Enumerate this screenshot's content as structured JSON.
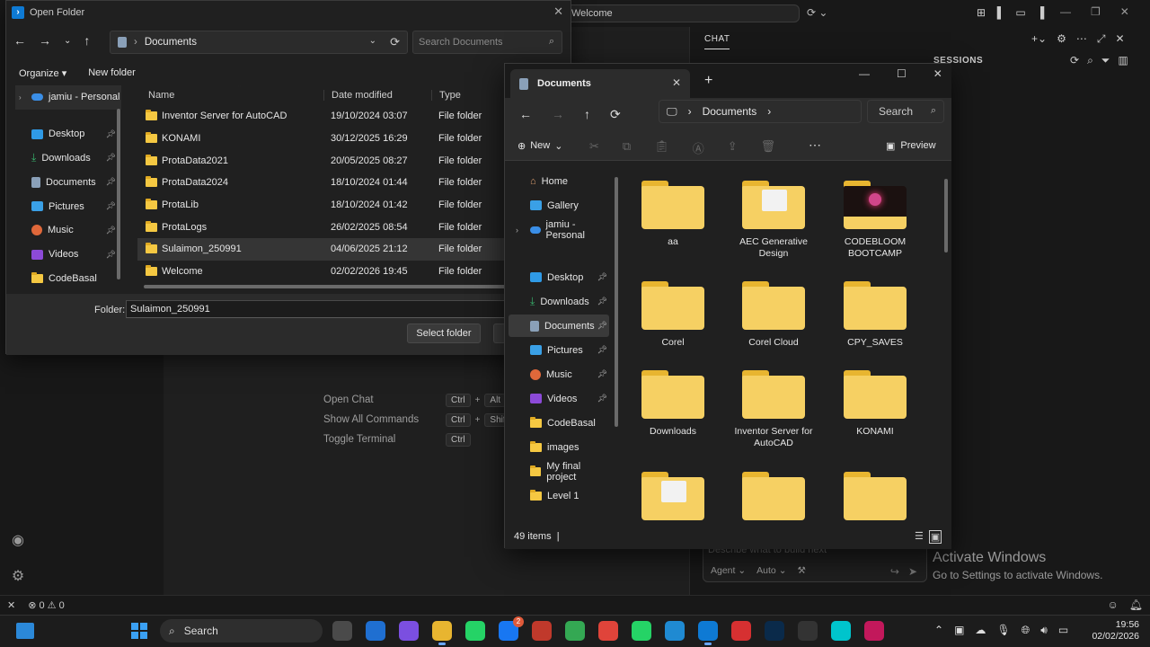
{
  "vscode": {
    "command_center": "Welcome",
    "chat_tab": "CHAT",
    "sessions_label": "SESSIONS",
    "hints": [
      {
        "label": "Open Chat",
        "keys": [
          "Ctrl",
          "Alt"
        ]
      },
      {
        "label": "Show All Commands",
        "keys": [
          "Ctrl",
          "Shift"
        ]
      },
      {
        "label": "Toggle Terminal",
        "keys": [
          "Ctrl"
        ]
      }
    ],
    "chat_placeholder": "Describe what to build next",
    "chat_mode": "Agent",
    "chat_model": "Auto",
    "status_errors": "0",
    "status_warnings": "0",
    "activate_title": "Activate Windows",
    "activate_sub": "Go to Settings to activate Windows."
  },
  "open_folder": {
    "title": "Open Folder",
    "address": "Documents",
    "search_placeholder": "Search Documents",
    "organize": "Organize",
    "new_folder": "New folder",
    "tree": [
      {
        "label": "jamiu - Personal",
        "icon": "cloud",
        "pinned": false
      },
      {
        "label": "Desktop",
        "icon": "desktop",
        "pinned": true
      },
      {
        "label": "Downloads",
        "icon": "download",
        "pinned": true
      },
      {
        "label": "Documents",
        "icon": "document",
        "pinned": true
      },
      {
        "label": "Pictures",
        "icon": "pictures",
        "pinned": true
      },
      {
        "label": "Music",
        "icon": "music",
        "pinned": true
      },
      {
        "label": "Videos",
        "icon": "videos",
        "pinned": true
      },
      {
        "label": "CodeBasal",
        "icon": "folder",
        "pinned": false
      }
    ],
    "columns": {
      "name": "Name",
      "date": "Date modified",
      "type": "Type"
    },
    "rows": [
      {
        "name": "Inventor Server for AutoCAD",
        "date": "19/10/2024 03:07",
        "type": "File folder"
      },
      {
        "name": "KONAMI",
        "date": "30/12/2025 16:29",
        "type": "File folder"
      },
      {
        "name": "ProtaData2021",
        "date": "20/05/2025 08:27",
        "type": "File folder"
      },
      {
        "name": "ProtaData2024",
        "date": "18/10/2024 01:44",
        "type": "File folder"
      },
      {
        "name": "ProtaLib",
        "date": "18/10/2024 01:42",
        "type": "File folder"
      },
      {
        "name": "ProtaLogs",
        "date": "26/02/2025 08:54",
        "type": "File folder"
      },
      {
        "name": "Sulaimon_250991",
        "date": "04/06/2025 21:12",
        "type": "File folder"
      },
      {
        "name": "Welcome",
        "date": "02/02/2026 19:45",
        "type": "File folder"
      }
    ],
    "selected_row": "Sulaimon_250991",
    "folder_label": "Folder:",
    "folder_value": "Sulaimon_250991",
    "select_button": "Select folder"
  },
  "explorer": {
    "tab_title": "Documents",
    "address": "Documents",
    "search": "Search",
    "new_label": "New",
    "preview_label": "Preview",
    "nav": [
      {
        "label": "Home",
        "icon": "home"
      },
      {
        "label": "Gallery",
        "icon": "gallery"
      },
      {
        "label": "jamiu - Personal",
        "icon": "cloud"
      },
      {
        "label": "Desktop",
        "icon": "desktop",
        "pinned": true
      },
      {
        "label": "Downloads",
        "icon": "download",
        "pinned": true
      },
      {
        "label": "Documents",
        "icon": "document",
        "pinned": true
      },
      {
        "label": "Pictures",
        "icon": "pictures",
        "pinned": true
      },
      {
        "label": "Music",
        "icon": "music",
        "pinned": true
      },
      {
        "label": "Videos",
        "icon": "videos",
        "pinned": true
      },
      {
        "label": "CodeBasal",
        "icon": "folder"
      },
      {
        "label": "images",
        "icon": "folder"
      },
      {
        "label": "My final project",
        "icon": "folder"
      },
      {
        "label": "Level 1",
        "icon": "folder"
      }
    ],
    "tiles": [
      {
        "name": "aa",
        "style": "plain"
      },
      {
        "name": "AEC Generative Design",
        "style": "paper"
      },
      {
        "name": "CODEBLOOM BOOTCAMP",
        "style": "dark"
      },
      {
        "name": "Corel",
        "style": "plain"
      },
      {
        "name": "Corel Cloud",
        "style": "plain"
      },
      {
        "name": "CPY_SAVES",
        "style": "plain"
      },
      {
        "name": "Downloads",
        "style": "plain"
      },
      {
        "name": "Inventor Server for AutoCAD",
        "style": "plain"
      },
      {
        "name": "KONAMI",
        "style": "plain"
      },
      {
        "name": "",
        "style": "paper"
      },
      {
        "name": "",
        "style": "plain"
      },
      {
        "name": "",
        "style": "plain"
      }
    ],
    "item_count": "49 items"
  },
  "taskbar": {
    "search": "Search",
    "time": "19:56",
    "date": "02/02/2026",
    "notification_count": "2",
    "apps": [
      {
        "name": "task-view",
        "color": "#4a4a4a"
      },
      {
        "name": "defender",
        "color": "#1f6fd1"
      },
      {
        "name": "copilot",
        "color": "#7b4fe0"
      },
      {
        "name": "file-explorer",
        "color": "#e8b530",
        "active": true
      },
      {
        "name": "whatsapp",
        "color": "#25d366"
      },
      {
        "name": "messenger",
        "color": "#1877f2",
        "badge": true
      },
      {
        "name": "brave",
        "color": "#c0392b"
      },
      {
        "name": "chrome",
        "color": "#34a853"
      },
      {
        "name": "recorder",
        "color": "#e0443a"
      },
      {
        "name": "whatsapp-2",
        "color": "#25d366"
      },
      {
        "name": "edge",
        "color": "#1f8ad2"
      },
      {
        "name": "vscode",
        "color": "#0e7ad4",
        "active": true
      },
      {
        "name": "wps",
        "color": "#d63031"
      },
      {
        "name": "photoshop",
        "color": "#0a2a4a"
      },
      {
        "name": "capcut",
        "color": "#333333"
      },
      {
        "name": "canva",
        "color": "#00c4cc"
      },
      {
        "name": "snipping",
        "color": "#c2185b"
      }
    ]
  }
}
